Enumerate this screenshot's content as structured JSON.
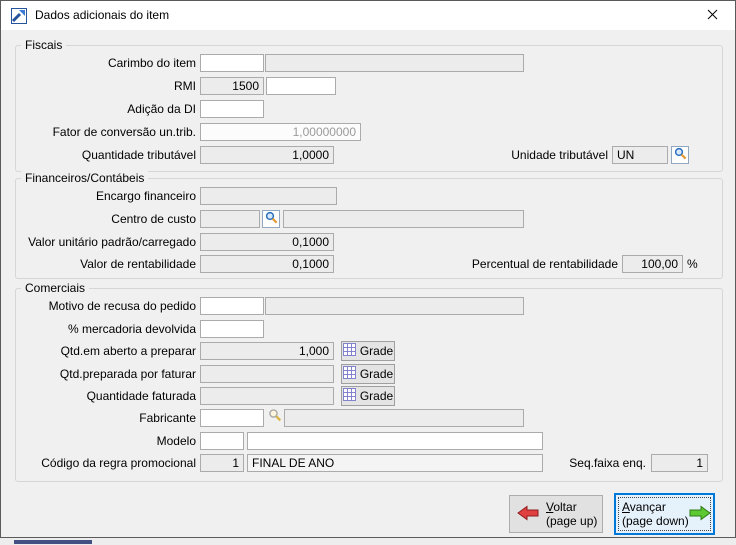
{
  "window": {
    "title": "Dados adicionais do item"
  },
  "titlebar": {
    "close_glyph": "✕"
  },
  "groups": {
    "fiscais": {
      "label": "Fiscais",
      "carimbo": {
        "label": "Carimbo do item",
        "code": "",
        "desc": ""
      },
      "rmi": {
        "label": "RMI",
        "value": "1500",
        "extra": ""
      },
      "adicao_di": {
        "label": "Adição da DI",
        "value": ""
      },
      "fator_conversao": {
        "label": "Fator de conversão un.trib.",
        "value": "1,00000000"
      },
      "quantidade_tributavel": {
        "label": "Quantidade tributável",
        "value": "1,0000"
      },
      "unidade_tributavel": {
        "label": "Unidade tributável",
        "value": "UN"
      }
    },
    "financeiros": {
      "label": "Financeiros/Contábeis",
      "encargo_financeiro": {
        "label": "Encargo financeiro",
        "value": ""
      },
      "centro_custo": {
        "label": "Centro de custo",
        "code": "",
        "desc": ""
      },
      "valor_unitario": {
        "label": "Valor unitário padrão/carregado",
        "value": "0,1000"
      },
      "valor_rentabilidade": {
        "label": "Valor de rentabilidade",
        "value": "0,1000"
      },
      "percentual_rentabilidade": {
        "label": "Percentual de rentabilidade",
        "value": "100,00",
        "suffix": "%"
      }
    },
    "comerciais": {
      "label": "Comerciais",
      "motivo_recusa": {
        "label": "Motivo de recusa do pedido",
        "code": "",
        "desc": ""
      },
      "pct_mercadoria_devolvida": {
        "label": "% mercadoria devolvida",
        "value": ""
      },
      "qtd_em_aberto": {
        "label": "Qtd.em aberto a preparar",
        "value": "1,000",
        "grade_label": "Grade"
      },
      "qtd_preparada": {
        "label": "Qtd.preparada por faturar",
        "value": "",
        "grade_label": "Grade"
      },
      "quantidade_faturada": {
        "label": "Quantidade faturada",
        "value": "",
        "grade_label": "Grade"
      },
      "fabricante": {
        "label": "Fabricante",
        "code": "",
        "desc": ""
      },
      "modelo": {
        "label": "Modelo",
        "code": "",
        "desc": ""
      },
      "regra_promocional": {
        "label": "Código da regra promocional",
        "code": "1",
        "desc": "FINAL DE ANO"
      },
      "seq_faixa_enq": {
        "label": "Seq.faixa enq.",
        "value": "1"
      }
    }
  },
  "footer": {
    "voltar": {
      "accel": "V",
      "rest": "oltar",
      "line2": "(page up)"
    },
    "avancar": {
      "accel": "A",
      "rest": "vançar",
      "line2": "(page down)"
    }
  },
  "icons": {
    "app": "chart-arrow-logo",
    "close": "close-x",
    "lookup": "magnifier",
    "fabricante_lookup": "magnifier-with-dropdown",
    "grade": "grid-table",
    "voltar": "red-arrow-left",
    "avancar": "green-arrow-right"
  },
  "colors": {
    "titlebar_bg": "#ffffff",
    "dialog_bg": "#f0f0f0",
    "readonly_field_bg": "#ececec",
    "focus_border": "#0078d7",
    "focus_bg": "#e5f1fb",
    "arrow_red": "#e14040",
    "arrow_green": "#5cc832",
    "grade_icon": "#8282cd",
    "disabled_text": "#9b9b9b"
  }
}
